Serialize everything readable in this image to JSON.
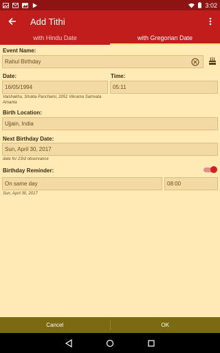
{
  "status_bar": {
    "time": "3:02"
  },
  "app_bar": {
    "title": "Add Tithi"
  },
  "tabs": [
    {
      "label": "with Hindu Date",
      "active": false
    },
    {
      "label": "with Gregorian Date",
      "active": true
    }
  ],
  "form": {
    "event_name": {
      "label": "Event Name:",
      "value": "Rahul Birthday"
    },
    "date": {
      "label": "Date:",
      "value": "16/05/1994",
      "hint": "Vaishakha, Shukla Panchami, 2051 Vikrama Samvata Amanta"
    },
    "time": {
      "label": "Time:",
      "value": "05:11"
    },
    "birth_location": {
      "label": "Birth Location:",
      "value": "Ujjain, India"
    },
    "next_birthday": {
      "label": "Next Birthday Date:",
      "value": "Sun, April 30, 2017",
      "hint": "date for 23rd observance"
    },
    "reminder": {
      "label": "Birthday Reminder:",
      "enabled": true,
      "when": "On same day",
      "time": "08:00",
      "hint": "Sun, April 30, 2017"
    }
  },
  "actions": {
    "cancel": "Cancel",
    "ok": "OK"
  },
  "colors": {
    "status_bar": "#8E1414",
    "app_bar": "#C21D1D",
    "background": "#FFE9B5",
    "field": "#F3D9A4",
    "bottom_bar": "#7C6A12",
    "accent": "#D32020"
  }
}
